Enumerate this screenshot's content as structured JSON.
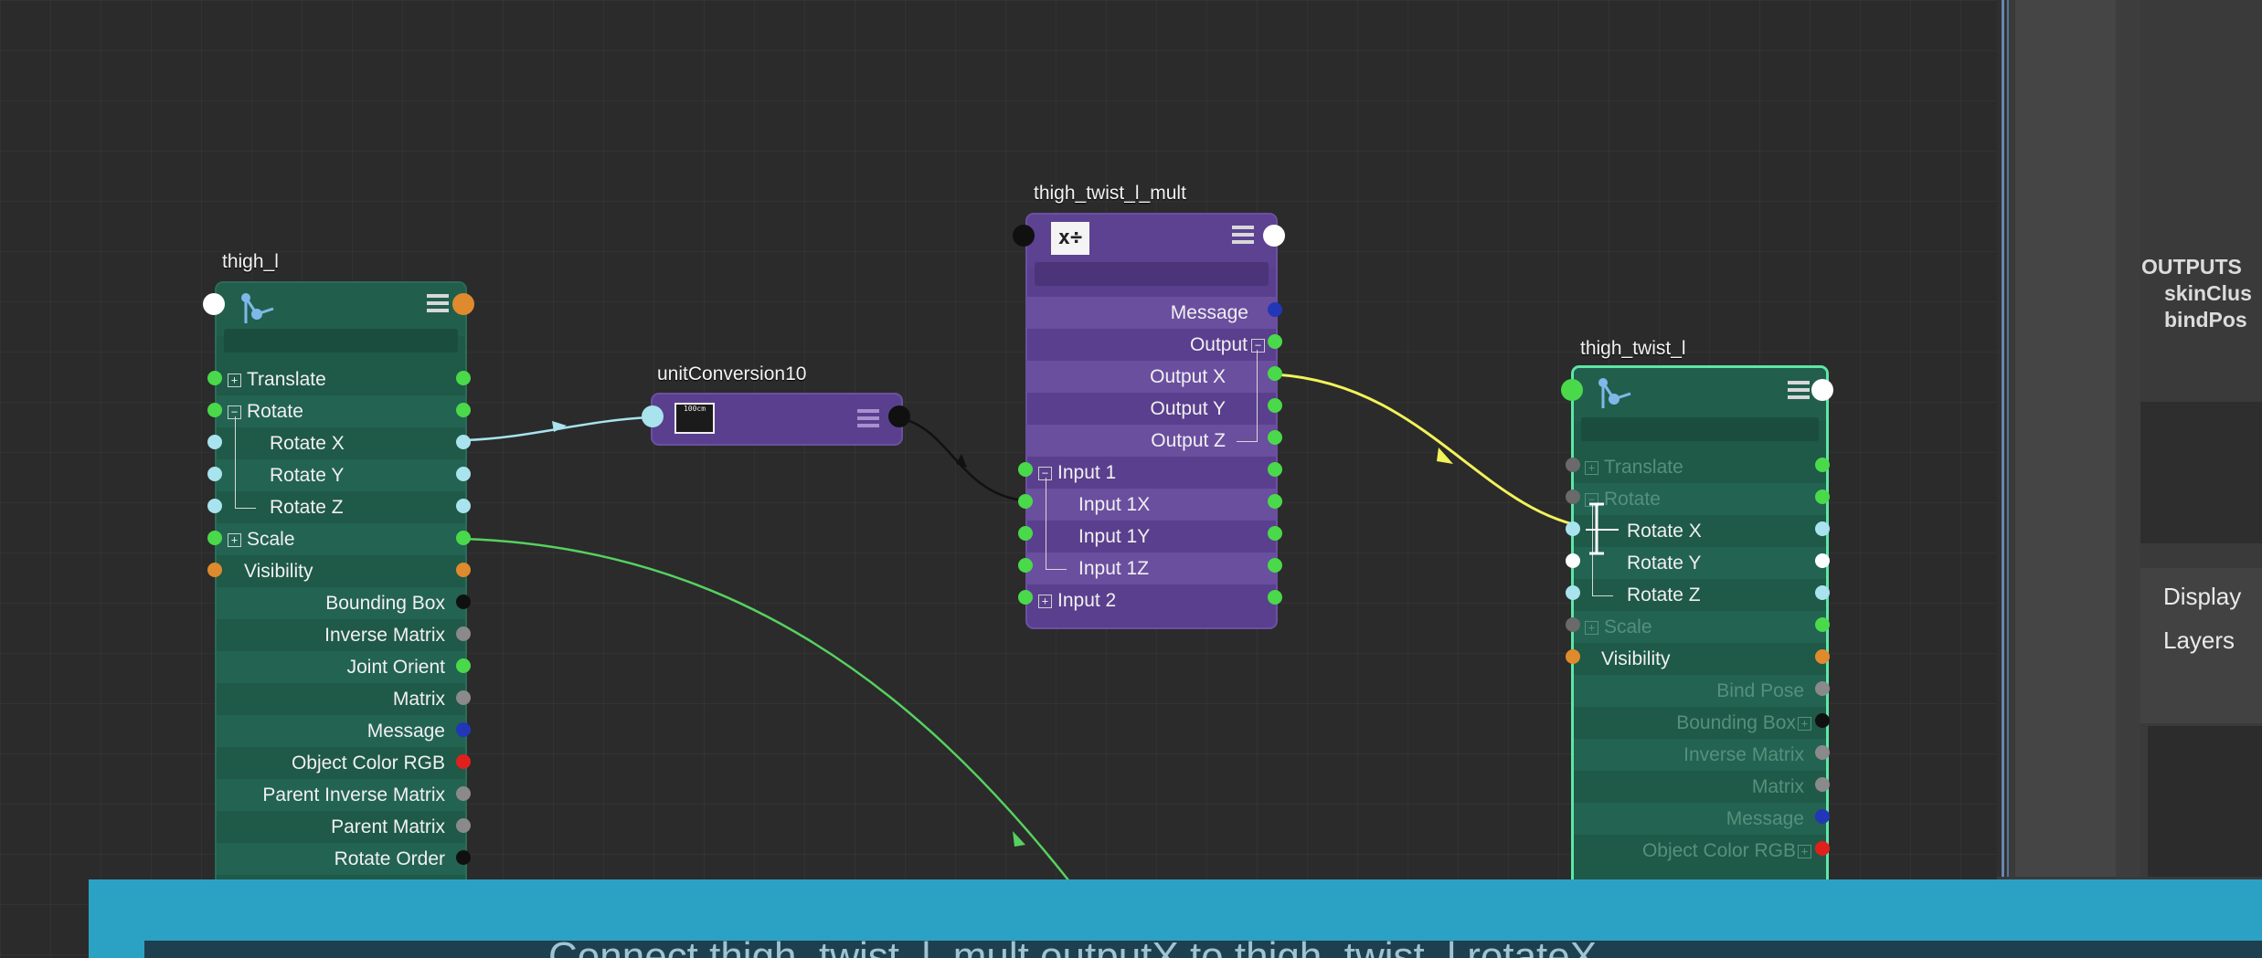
{
  "nodes": {
    "thigh_l": {
      "title": "thigh_l",
      "rows": [
        "Translate",
        "Rotate",
        "Rotate X",
        "Rotate Y",
        "Rotate Z",
        "Scale",
        "Visibility",
        "Bounding Box",
        "Inverse Matrix",
        "Joint Orient",
        "Matrix",
        "Message",
        "Object Color RGB",
        "Parent Inverse Matrix",
        "Parent Matrix",
        "Rotate Order"
      ]
    },
    "unitConversion10": {
      "title": "unitConversion10",
      "icon_text": "100cm"
    },
    "thigh_twist_l_mult": {
      "title": "thigh_twist_l_mult",
      "icon_text": "x÷",
      "rows": [
        "Message",
        "Output",
        "Output X",
        "Output Y",
        "Output Z",
        "Input 1",
        "Input 1X",
        "Input 1Y",
        "Input 1Z",
        "Input 2"
      ]
    },
    "thigh_twist_l": {
      "title": "thigh_twist_l",
      "rows": [
        "Translate",
        "Rotate",
        "Rotate X",
        "Rotate Y",
        "Rotate Z",
        "Scale",
        "Visibility",
        "Bind Pose",
        "Bounding Box",
        "Inverse Matrix",
        "Matrix",
        "Message",
        "Object Color RGB"
      ]
    }
  },
  "right_panel": {
    "outputs_label": "OUTPUTS",
    "outputs_items": [
      "skinClus",
      "bindPos"
    ],
    "display_tab": "Display",
    "layers_tab": "Layers"
  },
  "caption": {
    "text": "Connect thigh_twist_l_mult.outputX to thigh_twist_l.rotateX"
  },
  "colors": {
    "joint_node": "#1f5948",
    "math_node": "#5a3f8e",
    "selected_border": "#5ee6a6",
    "active_wire": "#f2f25a",
    "scale_wire": "#56d160",
    "caption_bar": "#2ba2c3"
  }
}
